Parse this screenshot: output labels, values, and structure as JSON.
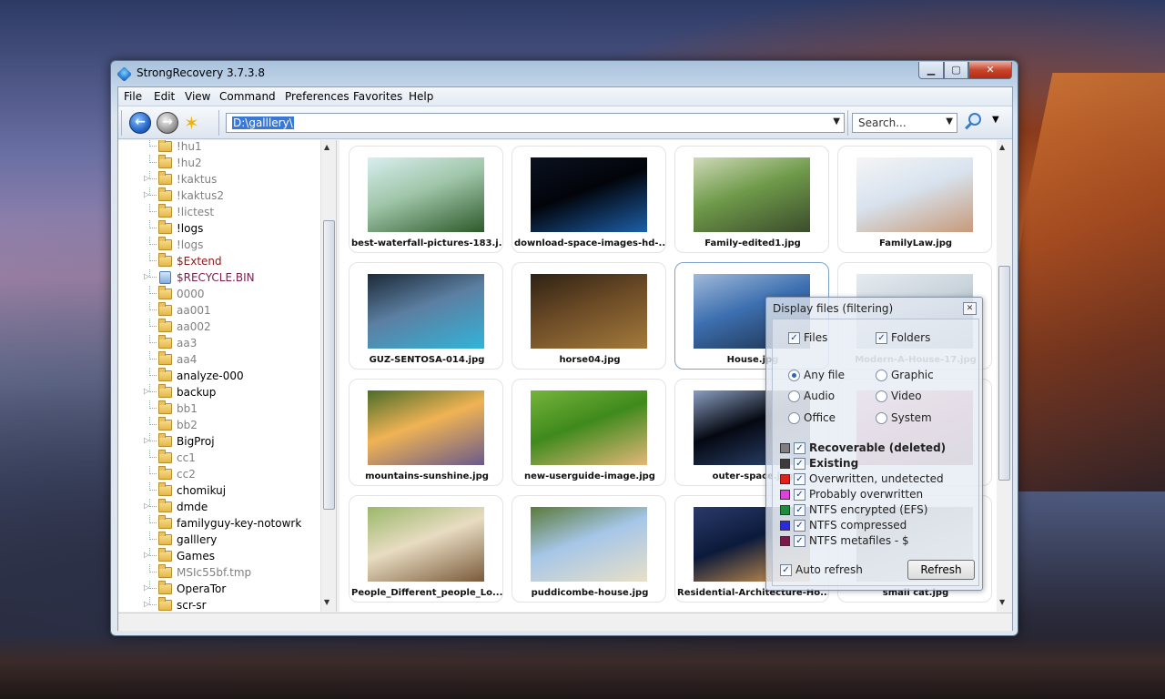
{
  "window": {
    "title": "StrongRecovery 3.7.3.8"
  },
  "menu": [
    "File",
    "Edit",
    "View",
    "Command",
    "Preferences",
    "Favorites",
    "Help"
  ],
  "toolbar": {
    "address": "D:\\galllery\\",
    "search_placeholder": "Search..."
  },
  "tree": [
    {
      "label": "!hu1",
      "style": "gray",
      "expand": false
    },
    {
      "label": "!hu2",
      "style": "gray",
      "expand": false
    },
    {
      "label": "!kaktus",
      "style": "gray",
      "expand": true
    },
    {
      "label": "!kaktus2",
      "style": "gray",
      "expand": true
    },
    {
      "label": "!lictest",
      "style": "gray",
      "expand": false
    },
    {
      "label": "!logs",
      "style": "black",
      "expand": false
    },
    {
      "label": "!logs",
      "style": "gray",
      "expand": false
    },
    {
      "label": "$Extend",
      "style": "red",
      "expand": false
    },
    {
      "label": "$RECYCLE.BIN",
      "style": "pink",
      "expand": true,
      "icon": "recycle-bin"
    },
    {
      "label": "0000",
      "style": "gray",
      "expand": false
    },
    {
      "label": "aa001",
      "style": "gray",
      "expand": false
    },
    {
      "label": "aa002",
      "style": "gray",
      "expand": false
    },
    {
      "label": "aa3",
      "style": "gray",
      "expand": false
    },
    {
      "label": "aa4",
      "style": "gray",
      "expand": false
    },
    {
      "label": "analyze-000",
      "style": "black",
      "expand": false
    },
    {
      "label": "backup",
      "style": "black",
      "expand": true
    },
    {
      "label": "bb1",
      "style": "gray",
      "expand": false
    },
    {
      "label": "bb2",
      "style": "gray",
      "expand": false
    },
    {
      "label": "BigProj",
      "style": "black",
      "expand": true
    },
    {
      "label": "cc1",
      "style": "gray",
      "expand": false
    },
    {
      "label": "cc2",
      "style": "gray",
      "expand": false
    },
    {
      "label": "chomikuj",
      "style": "black",
      "expand": false
    },
    {
      "label": "dmde",
      "style": "black",
      "expand": true
    },
    {
      "label": "familyguy-key-notowrk",
      "style": "black",
      "expand": false
    },
    {
      "label": "galllery",
      "style": "black",
      "expand": false
    },
    {
      "label": "Games",
      "style": "black",
      "expand": true
    },
    {
      "label": "MSIc55bf.tmp",
      "style": "gray",
      "expand": false
    },
    {
      "label": "OperaTor",
      "style": "black",
      "expand": true
    },
    {
      "label": "scr-sr",
      "style": "black",
      "expand": true
    }
  ],
  "files": [
    {
      "name": "best-waterfall-pictures-183.j...",
      "colors": [
        "#9fc5a8",
        "#2d5a2b",
        "#d9eef0"
      ]
    },
    {
      "name": "download-space-images-hd-...",
      "colors": [
        "#02040a",
        "#1d5fa8",
        "#0b1120"
      ]
    },
    {
      "name": "Family-edited1.jpg",
      "colors": [
        "#6f9a4a",
        "#3b4c2c",
        "#cfd9b8"
      ]
    },
    {
      "name": "FamilyLaw.jpg",
      "colors": [
        "#d8e3ef",
        "#c79a7a",
        "#f5f5f5"
      ]
    },
    {
      "name": "GUZ-SENTOSA-014.jpg",
      "colors": [
        "#5c7fa2",
        "#32b3d8",
        "#1c2a38"
      ]
    },
    {
      "name": "horse04.jpg",
      "colors": [
        "#6b4a26",
        "#a37a3c",
        "#2e2214"
      ]
    },
    {
      "name": "House.jpg",
      "colors": [
        "#3d6fb0",
        "#1c2f4a",
        "#a0b9d8"
      ]
    },
    {
      "name": "Modern-A-House-17.jpg",
      "colors": [
        "#c9d3dc",
        "#7b8c99",
        "#e6ecf0"
      ]
    },
    {
      "name": "mountains-sunshine.jpg",
      "colors": [
        "#f0b354",
        "#6a5a8a",
        "#4b6d2a"
      ]
    },
    {
      "name": "new-userguide-image.jpg",
      "colors": [
        "#3f8a1c",
        "#e2b779",
        "#76b33c"
      ]
    },
    {
      "name": "outer-space.jpg",
      "colors": [
        "#050812",
        "#304a78",
        "#8a9ec0"
      ]
    },
    {
      "name": "",
      "colors": [
        "#c44a6a",
        "#6a2a3a",
        "#e0a0b0"
      ]
    },
    {
      "name": "People_Different_people_Lo...",
      "colors": [
        "#e8dcc2",
        "#7a5a3a",
        "#9ab86a"
      ]
    },
    {
      "name": "puddicombe-house.jpg",
      "colors": [
        "#a6c6e8",
        "#e8e0c8",
        "#5a7a3a"
      ]
    },
    {
      "name": "Residential-Architecture-Ho...",
      "colors": [
        "#0b1a3a",
        "#e0a050",
        "#2a3a6a"
      ]
    },
    {
      "name": "small cat.jpg",
      "colors": [
        "#8a8a8a",
        "#cfcfcf",
        "#5a5a5a"
      ]
    }
  ],
  "filter_dialog": {
    "title": "Display files (filtering)",
    "files_label": "Files",
    "folders_label": "Folders",
    "types": [
      "Any file",
      "Graphic",
      "Audio",
      "Video",
      "Office",
      "System"
    ],
    "selected_type": "Any file",
    "statuses": [
      {
        "label": "Recoverable (deleted)",
        "color": "#7f7f7f",
        "bold": true
      },
      {
        "label": "Existing",
        "color": "#3c3c3c",
        "bold": true
      },
      {
        "label": "Overwritten, undetected",
        "color": "#e0201a",
        "bold": false
      },
      {
        "label": "Probably overwritten",
        "color": "#e040e0",
        "bold": false
      },
      {
        "label": "NTFS encrypted (EFS)",
        "color": "#228a3c",
        "bold": false
      },
      {
        "label": "NTFS compressed",
        "color": "#2a2ae0",
        "bold": false
      },
      {
        "label": "NTFS metafiles - $",
        "color": "#7a1a4a",
        "bold": false
      }
    ],
    "auto_refresh_label": "Auto refresh",
    "refresh_label": "Refresh"
  }
}
